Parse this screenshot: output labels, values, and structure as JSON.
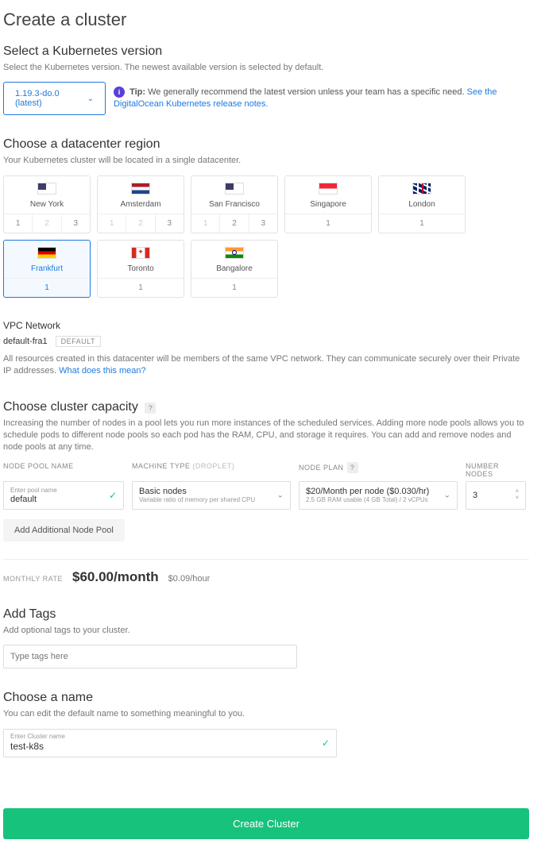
{
  "title": "Create a cluster",
  "version": {
    "heading": "Select a Kubernetes version",
    "sub": "Select the Kubernetes version. The newest available version is selected by default.",
    "selected": "1.19.3-do.0 (latest)",
    "tip_label": "Tip:",
    "tip_body": "We generally recommend the latest version unless your team has a specific need.",
    "tip_link": "See the DigitalOcean Kubernetes release notes."
  },
  "region": {
    "heading": "Choose a datacenter region",
    "sub": "Your Kubernetes cluster will be located in a single datacenter.",
    "items": [
      {
        "name": "New York",
        "flag": "flag-us",
        "zones": [
          {
            "n": "1"
          },
          {
            "n": "2",
            "disabled": true
          },
          {
            "n": "3"
          }
        ]
      },
      {
        "name": "Amsterdam",
        "flag": "flag-nl",
        "zones": [
          {
            "n": "1",
            "disabled": true
          },
          {
            "n": "2",
            "disabled": true
          },
          {
            "n": "3"
          }
        ]
      },
      {
        "name": "San Francisco",
        "flag": "flag-us",
        "zones": [
          {
            "n": "1",
            "disabled": true
          },
          {
            "n": "2"
          },
          {
            "n": "3"
          }
        ]
      },
      {
        "name": "Singapore",
        "flag": "flag-sg",
        "zones": [
          {
            "n": "1"
          }
        ]
      },
      {
        "name": "London",
        "flag": "flag-uk",
        "zones": [
          {
            "n": "1"
          }
        ]
      },
      {
        "name": "Frankfurt",
        "flag": "flag-de",
        "zones": [
          {
            "n": "1",
            "sel": true
          }
        ],
        "selected": true
      },
      {
        "name": "Toronto",
        "flag": "flag-ca",
        "zones": [
          {
            "n": "1"
          }
        ]
      },
      {
        "name": "Bangalore",
        "flag": "flag-in",
        "zones": [
          {
            "n": "1"
          }
        ]
      }
    ]
  },
  "vpc": {
    "heading": "VPC Network",
    "name": "default-fra1",
    "badge": "DEFAULT",
    "desc": "All resources created in this datacenter will be members of the same VPC network. They can communicate securely over their Private IP addresses.",
    "link": "What does this mean?"
  },
  "capacity": {
    "heading": "Choose cluster capacity",
    "sub": "Increasing the number of nodes in a pool lets you run more instances of the scheduled services. Adding more node pools allows you to schedule pods to different node pools so each pod has the RAM, CPU, and storage it requires. You can add and remove nodes and node pools at any time.",
    "cols": {
      "pool": "NODE POOL NAME",
      "machine": "MACHINE TYPE",
      "machine_sub": "(DROPLET)",
      "plan": "NODE PLAN",
      "num": "NUMBER NODES"
    },
    "pool_label": "Enter pool name",
    "pool_value": "default",
    "machine_value": "Basic nodes",
    "machine_sub": "Variable ratio of memory per shared CPU",
    "plan_value": "$20/Month per node ($0.030/hr)",
    "plan_sub": "2.5 GB RAM usable (4 GB Total) / 2 vCPUs",
    "num_value": "3",
    "add_pool": "Add Additional Node Pool"
  },
  "rate": {
    "label": "MONTHLY RATE",
    "value": "$60.00/month",
    "hour": "$0.09/hour"
  },
  "tags": {
    "heading": "Add Tags",
    "sub": "Add optional tags to your cluster.",
    "placeholder": "Type tags here"
  },
  "name": {
    "heading": "Choose a name",
    "sub": "You can edit the default name to something meaningful to you.",
    "label": "Enter Cluster name",
    "value": "test-k8s"
  },
  "create": "Create Cluster"
}
